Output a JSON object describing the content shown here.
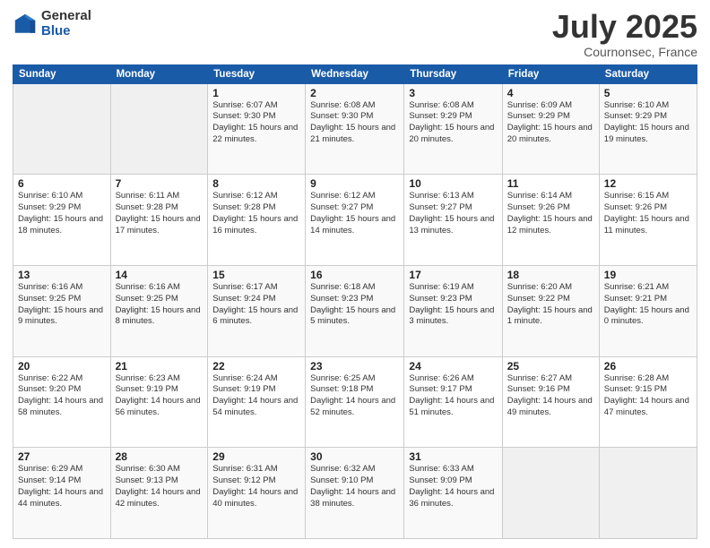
{
  "logo": {
    "general": "General",
    "blue": "Blue"
  },
  "header": {
    "month": "July 2025",
    "location": "Cournonsec, France"
  },
  "days_of_week": [
    "Sunday",
    "Monday",
    "Tuesday",
    "Wednesday",
    "Thursday",
    "Friday",
    "Saturday"
  ],
  "weeks": [
    [
      {
        "day": "",
        "sunrise": "",
        "sunset": "",
        "daylight": ""
      },
      {
        "day": "",
        "sunrise": "",
        "sunset": "",
        "daylight": ""
      },
      {
        "day": "1",
        "sunrise": "Sunrise: 6:07 AM",
        "sunset": "Sunset: 9:30 PM",
        "daylight": "Daylight: 15 hours and 22 minutes."
      },
      {
        "day": "2",
        "sunrise": "Sunrise: 6:08 AM",
        "sunset": "Sunset: 9:30 PM",
        "daylight": "Daylight: 15 hours and 21 minutes."
      },
      {
        "day": "3",
        "sunrise": "Sunrise: 6:08 AM",
        "sunset": "Sunset: 9:29 PM",
        "daylight": "Daylight: 15 hours and 20 minutes."
      },
      {
        "day": "4",
        "sunrise": "Sunrise: 6:09 AM",
        "sunset": "Sunset: 9:29 PM",
        "daylight": "Daylight: 15 hours and 20 minutes."
      },
      {
        "day": "5",
        "sunrise": "Sunrise: 6:10 AM",
        "sunset": "Sunset: 9:29 PM",
        "daylight": "Daylight: 15 hours and 19 minutes."
      }
    ],
    [
      {
        "day": "6",
        "sunrise": "Sunrise: 6:10 AM",
        "sunset": "Sunset: 9:29 PM",
        "daylight": "Daylight: 15 hours and 18 minutes."
      },
      {
        "day": "7",
        "sunrise": "Sunrise: 6:11 AM",
        "sunset": "Sunset: 9:28 PM",
        "daylight": "Daylight: 15 hours and 17 minutes."
      },
      {
        "day": "8",
        "sunrise": "Sunrise: 6:12 AM",
        "sunset": "Sunset: 9:28 PM",
        "daylight": "Daylight: 15 hours and 16 minutes."
      },
      {
        "day": "9",
        "sunrise": "Sunrise: 6:12 AM",
        "sunset": "Sunset: 9:27 PM",
        "daylight": "Daylight: 15 hours and 14 minutes."
      },
      {
        "day": "10",
        "sunrise": "Sunrise: 6:13 AM",
        "sunset": "Sunset: 9:27 PM",
        "daylight": "Daylight: 15 hours and 13 minutes."
      },
      {
        "day": "11",
        "sunrise": "Sunrise: 6:14 AM",
        "sunset": "Sunset: 9:26 PM",
        "daylight": "Daylight: 15 hours and 12 minutes."
      },
      {
        "day": "12",
        "sunrise": "Sunrise: 6:15 AM",
        "sunset": "Sunset: 9:26 PM",
        "daylight": "Daylight: 15 hours and 11 minutes."
      }
    ],
    [
      {
        "day": "13",
        "sunrise": "Sunrise: 6:16 AM",
        "sunset": "Sunset: 9:25 PM",
        "daylight": "Daylight: 15 hours and 9 minutes."
      },
      {
        "day": "14",
        "sunrise": "Sunrise: 6:16 AM",
        "sunset": "Sunset: 9:25 PM",
        "daylight": "Daylight: 15 hours and 8 minutes."
      },
      {
        "day": "15",
        "sunrise": "Sunrise: 6:17 AM",
        "sunset": "Sunset: 9:24 PM",
        "daylight": "Daylight: 15 hours and 6 minutes."
      },
      {
        "day": "16",
        "sunrise": "Sunrise: 6:18 AM",
        "sunset": "Sunset: 9:23 PM",
        "daylight": "Daylight: 15 hours and 5 minutes."
      },
      {
        "day": "17",
        "sunrise": "Sunrise: 6:19 AM",
        "sunset": "Sunset: 9:23 PM",
        "daylight": "Daylight: 15 hours and 3 minutes."
      },
      {
        "day": "18",
        "sunrise": "Sunrise: 6:20 AM",
        "sunset": "Sunset: 9:22 PM",
        "daylight": "Daylight: 15 hours and 1 minute."
      },
      {
        "day": "19",
        "sunrise": "Sunrise: 6:21 AM",
        "sunset": "Sunset: 9:21 PM",
        "daylight": "Daylight: 15 hours and 0 minutes."
      }
    ],
    [
      {
        "day": "20",
        "sunrise": "Sunrise: 6:22 AM",
        "sunset": "Sunset: 9:20 PM",
        "daylight": "Daylight: 14 hours and 58 minutes."
      },
      {
        "day": "21",
        "sunrise": "Sunrise: 6:23 AM",
        "sunset": "Sunset: 9:19 PM",
        "daylight": "Daylight: 14 hours and 56 minutes."
      },
      {
        "day": "22",
        "sunrise": "Sunrise: 6:24 AM",
        "sunset": "Sunset: 9:19 PM",
        "daylight": "Daylight: 14 hours and 54 minutes."
      },
      {
        "day": "23",
        "sunrise": "Sunrise: 6:25 AM",
        "sunset": "Sunset: 9:18 PM",
        "daylight": "Daylight: 14 hours and 52 minutes."
      },
      {
        "day": "24",
        "sunrise": "Sunrise: 6:26 AM",
        "sunset": "Sunset: 9:17 PM",
        "daylight": "Daylight: 14 hours and 51 minutes."
      },
      {
        "day": "25",
        "sunrise": "Sunrise: 6:27 AM",
        "sunset": "Sunset: 9:16 PM",
        "daylight": "Daylight: 14 hours and 49 minutes."
      },
      {
        "day": "26",
        "sunrise": "Sunrise: 6:28 AM",
        "sunset": "Sunset: 9:15 PM",
        "daylight": "Daylight: 14 hours and 47 minutes."
      }
    ],
    [
      {
        "day": "27",
        "sunrise": "Sunrise: 6:29 AM",
        "sunset": "Sunset: 9:14 PM",
        "daylight": "Daylight: 14 hours and 44 minutes."
      },
      {
        "day": "28",
        "sunrise": "Sunrise: 6:30 AM",
        "sunset": "Sunset: 9:13 PM",
        "daylight": "Daylight: 14 hours and 42 minutes."
      },
      {
        "day": "29",
        "sunrise": "Sunrise: 6:31 AM",
        "sunset": "Sunset: 9:12 PM",
        "daylight": "Daylight: 14 hours and 40 minutes."
      },
      {
        "day": "30",
        "sunrise": "Sunrise: 6:32 AM",
        "sunset": "Sunset: 9:10 PM",
        "daylight": "Daylight: 14 hours and 38 minutes."
      },
      {
        "day": "31",
        "sunrise": "Sunrise: 6:33 AM",
        "sunset": "Sunset: 9:09 PM",
        "daylight": "Daylight: 14 hours and 36 minutes."
      },
      {
        "day": "",
        "sunrise": "",
        "sunset": "",
        "daylight": ""
      },
      {
        "day": "",
        "sunrise": "",
        "sunset": "",
        "daylight": ""
      }
    ]
  ]
}
